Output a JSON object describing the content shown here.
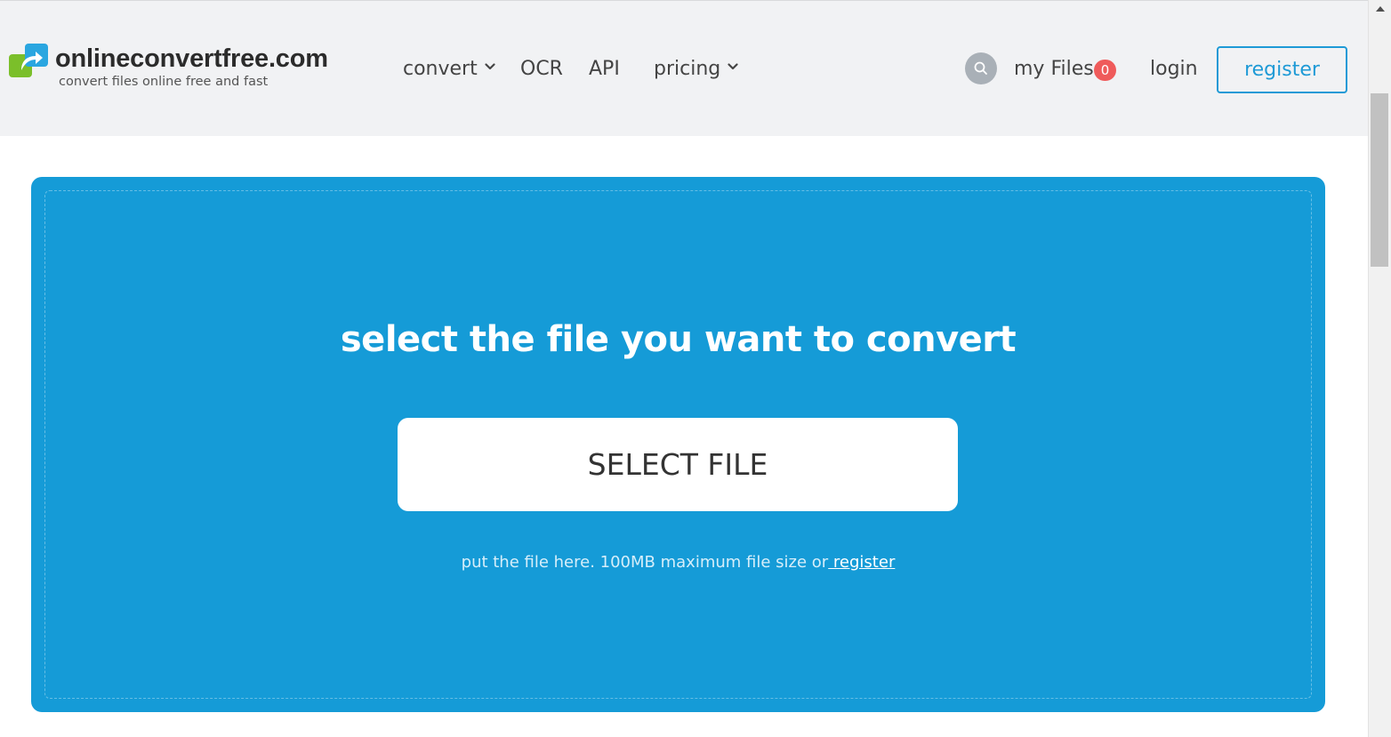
{
  "header": {
    "logo_text": "onlineconvertfree.com",
    "logo_tagline": "convert files online free and fast",
    "nav": {
      "convert": "convert",
      "ocr": "OCR",
      "api": "API",
      "pricing": "pricing"
    },
    "my_files_label": "my Files",
    "my_files_count": "0",
    "login_label": "login",
    "register_label": "register"
  },
  "upload": {
    "title": "select the file you want to convert",
    "select_button": "SELECT FILE",
    "hint_text": "put the file here. 100MB maximum file size or",
    "hint_link": " register"
  },
  "colors": {
    "header_bg": "#f1f2f4",
    "upload_bg": "#159bd7",
    "accent": "#1e9ad6",
    "badge": "#ef5b5b"
  }
}
